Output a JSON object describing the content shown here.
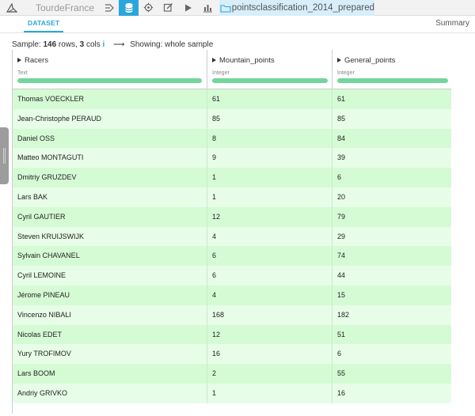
{
  "nav": {
    "project": "TourdeFrance",
    "icons": [
      "flow-icon",
      "datasets-icon",
      "recipes-icon",
      "notebooks-icon",
      "jobs-icon",
      "dashboards-icon"
    ],
    "active_index": 1,
    "dataset_name": "pointsclassification_2014_prepared",
    "accent": "#2aa6dc"
  },
  "subnav": {
    "tab": "DATASET",
    "summary": "Summary"
  },
  "sample": {
    "prefix": "Sample: ",
    "rows": "146",
    "rows_label": " rows, ",
    "cols": "3",
    "cols_label": " cols",
    "info": "i",
    "arrow": "⟶",
    "showing": "Showing: whole sample"
  },
  "columns": [
    {
      "name": "Racers",
      "type": "Text"
    },
    {
      "name": "Mountain_points",
      "type": "Integer"
    },
    {
      "name": "General_points",
      "type": "Integer"
    }
  ],
  "rows": [
    [
      "Thomas VOECKLER",
      "61",
      "61"
    ],
    [
      "Jean-Christophe PERAUD",
      "85",
      "85"
    ],
    [
      "Daniel OSS",
      "8",
      "84"
    ],
    [
      "Matteo MONTAGUTI",
      "9",
      "39"
    ],
    [
      "Dmitriy GRUZDEV",
      "1",
      "6"
    ],
    [
      "Lars BAK",
      "1",
      "20"
    ],
    [
      "Cyril GAUTIER",
      "12",
      "79"
    ],
    [
      "Steven KRUIJSWIJK",
      "4",
      "29"
    ],
    [
      "Sylvain CHAVANEL",
      "6",
      "74"
    ],
    [
      "Cyril LEMOINE",
      "6",
      "44"
    ],
    [
      "Jérome PINEAU",
      "4",
      "15"
    ],
    [
      "Vincenzo NIBALI",
      "168",
      "182"
    ],
    [
      "Nicolas EDET",
      "12",
      "51"
    ],
    [
      "Yury TROFIMOV",
      "16",
      "6"
    ],
    [
      "Lars BOOM",
      "2",
      "55"
    ],
    [
      "Andriy GRIVKO",
      "1",
      "16"
    ]
  ],
  "colors": {
    "row_odd": "#d5fbd5",
    "row_even": "#e7fde7",
    "valid_bar": "#74d59c"
  }
}
